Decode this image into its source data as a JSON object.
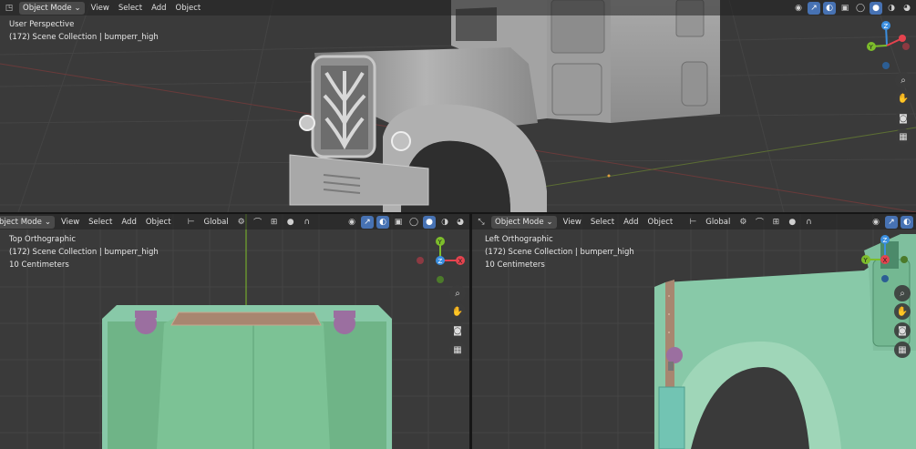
{
  "top": {
    "mode": "Object Mode",
    "menus": [
      "View",
      "Select",
      "Add",
      "Object"
    ],
    "view_name": "User Perspective",
    "collection": "(172) Scene Collection | bumperr_high"
  },
  "bottom_left": {
    "mode": "bject Mode",
    "menus": [
      "View",
      "Select",
      "Add",
      "Object"
    ],
    "transform": "Global",
    "view_name": "Top Orthographic",
    "collection": "(172) Scene Collection | bumperr_high",
    "scale": "10 Centimeters"
  },
  "bottom_right": {
    "mode": "Object Mode",
    "menus": [
      "View",
      "Select",
      "Add",
      "Object"
    ],
    "transform": "Global",
    "view_name": "Left Orthographic",
    "collection": "(172) Scene Collection | bumperr_high",
    "scale": "10 Centimeters"
  },
  "gizmo_labels": {
    "x": "X",
    "y": "Y",
    "z": "Z"
  },
  "colors": {
    "x_axis": "#e5434e",
    "y_axis": "#7dbd2b",
    "z_axis": "#3b8fe0",
    "active": "#4772b3",
    "mesh_gray": "#9c9c9c",
    "mesh_green": "#7ec49a",
    "bumper": "#a88670",
    "lamp": "#9b6fa0"
  },
  "icons": [
    "zoom-icon",
    "hand-icon",
    "camera-icon",
    "grid-icon"
  ]
}
